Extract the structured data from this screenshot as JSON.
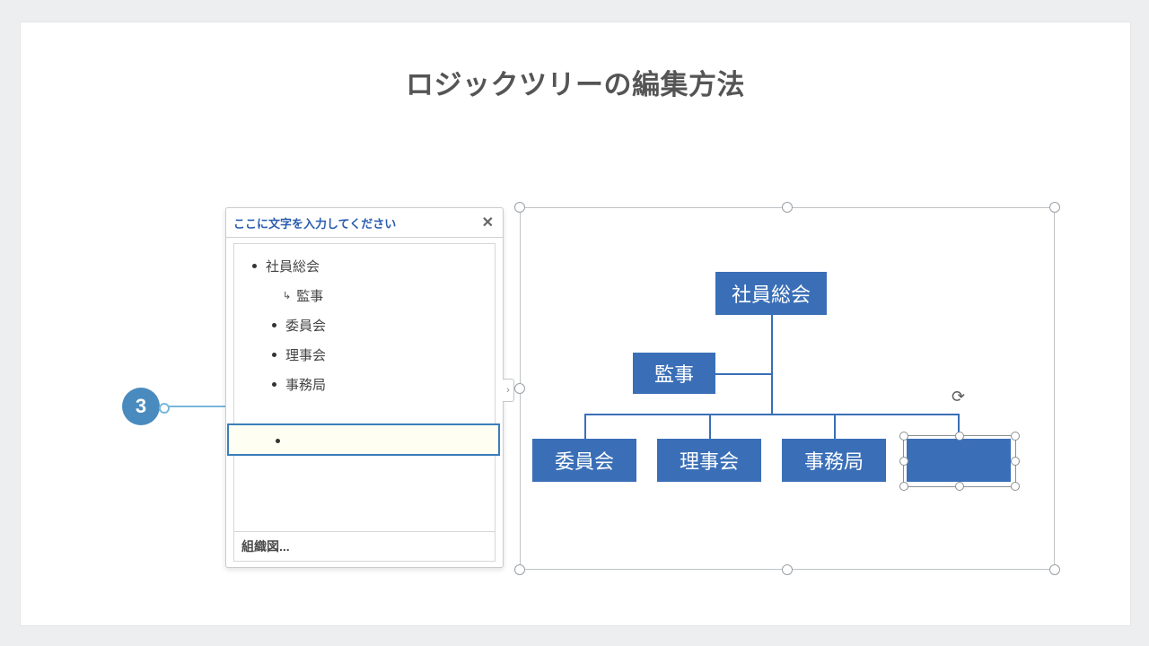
{
  "title": "ロジックツリーの編集方法",
  "step_number": "3",
  "text_panel": {
    "header": "ここに文字を入力してください",
    "close_glyph": "✕",
    "footer": "組織図...",
    "expand_glyph": "›",
    "items": {
      "root": "社員総会",
      "child_assist": "監事",
      "child_1": "委員会",
      "child_2": "理事会",
      "child_3": "事務局",
      "child_new": ""
    },
    "assist_arrow": "↳"
  },
  "diagram": {
    "rotate_glyph": "⟳",
    "nodes": {
      "top": "社員総会",
      "assist": "監事",
      "c1": "委員会",
      "c2": "理事会",
      "c3": "事務局",
      "c4": ""
    }
  }
}
